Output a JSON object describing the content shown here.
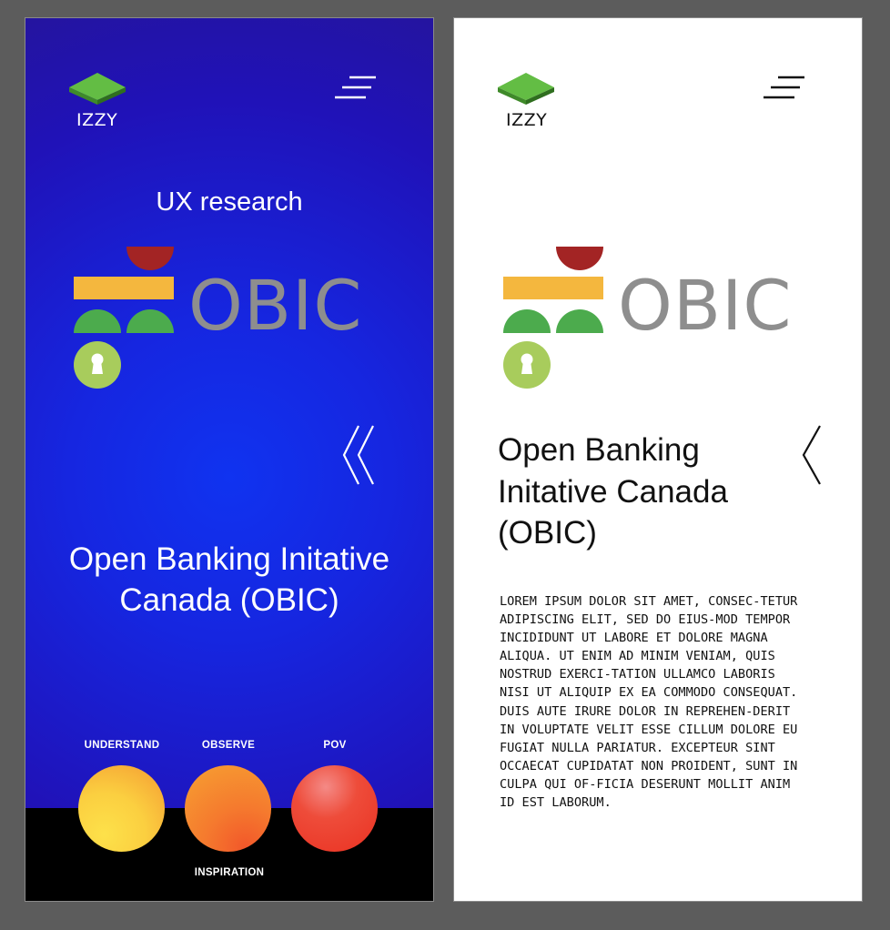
{
  "brand": {
    "name": "IZZY",
    "obic_wordmark": "OBIC"
  },
  "left_screen": {
    "subtitle": "UX research",
    "title": "Open Banking Initative Canada (OBIC)",
    "stages": [
      {
        "label": "UNDERSTAND"
      },
      {
        "label": "OBSERVE"
      },
      {
        "label": "POV"
      }
    ],
    "bottom_label": "INSPIRATION"
  },
  "right_screen": {
    "title": "Open Banking Initative Canada (OBIC)",
    "body": "LOREM IPSUM DOLOR SIT AMET, CONSEC-TETUR ADIPISCING ELIT, SED DO EIUS-MOD TEMPOR INCIDIDUNT UT LABORE ET DOLORE MAGNA ALIQUA. UT ENIM AD MINIM VENIAM, QUIS NOSTRUD EXERCI-TATION ULLAMCO LABORIS NISI UT ALIQUIP EX EA COMMODO CONSEQUAT. DUIS AUTE IRURE DOLOR IN REPREHEN-DERIT IN VOLUPTATE VELIT ESSE CILLUM DOLORE EU FUGIAT NULLA PARIATUR. EXCEPTEUR SINT OCCAECAT CUPIDATAT NON PROIDENT, SUNT IN CULPA QUI OF-FICIA DESERUNT MOLLIT ANIM ID EST LABORUM."
  },
  "icons": {
    "logo": "green-isometric-tile-icon",
    "menu": "hamburger-menu-icon",
    "back_left": "double-chevron-left-icon",
    "back_right": "chevron-left-icon",
    "obic_logo": "obic-logo"
  },
  "colors": {
    "left_background": "#1626e0",
    "logo_green": "#5db33c",
    "obic_yellow": "#f4b73e",
    "obic_red": "#a32424",
    "obic_green": "#4cab4d",
    "obic_lime": "#a8cc5c",
    "obic_gray": "#8e8e8e",
    "understand_circle": "#fbcf40",
    "observe_circle": "#f59a2f",
    "pov_circle": "#ec3a2a"
  }
}
